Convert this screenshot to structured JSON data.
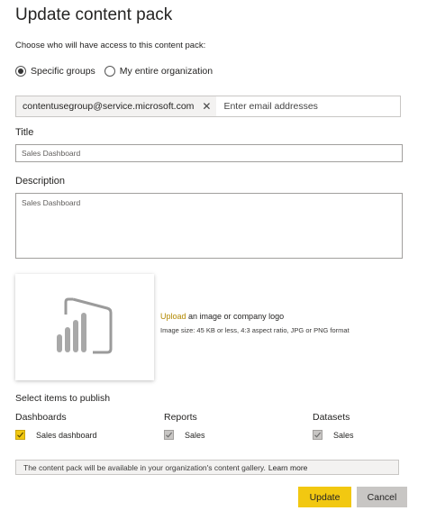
{
  "dialog": {
    "title": "Update content pack",
    "access_prompt": "Choose who will have access to this content pack:",
    "access_options": [
      {
        "label": "Specific groups",
        "selected": true
      },
      {
        "label": "My entire organization",
        "selected": false
      }
    ]
  },
  "recipients": {
    "chips": [
      "contentusegroup@service.microsoft.com"
    ],
    "placeholder": "Enter email addresses"
  },
  "title_field": {
    "label": "Title",
    "value": "Sales Dashboard"
  },
  "description_field": {
    "label": "Description",
    "value": "Sales Dashboard"
  },
  "image_upload": {
    "link_text": "Upload",
    "rest_text": " an image or company logo",
    "hint": "Image size: 45 KB or less, 4:3 aspect ratio, JPG or PNG format"
  },
  "publish": {
    "heading": "Select items to publish",
    "columns": [
      {
        "heading": "Dashboards",
        "items": [
          {
            "label": "Sales dashboard",
            "checked": true,
            "enabled": true
          }
        ]
      },
      {
        "heading": "Reports",
        "items": [
          {
            "label": "Sales",
            "checked": true,
            "enabled": false
          }
        ]
      },
      {
        "heading": "Datasets",
        "items": [
          {
            "label": "Sales",
            "checked": true,
            "enabled": false
          }
        ]
      }
    ]
  },
  "info": {
    "text": "The content pack will be available in your organization's content gallery.",
    "link": "Learn more"
  },
  "buttons": {
    "update": "Update",
    "cancel": "Cancel"
  },
  "colors": {
    "accent": "#F2C811",
    "link": "#B28800",
    "disabled_check": "#C8C6C4"
  }
}
